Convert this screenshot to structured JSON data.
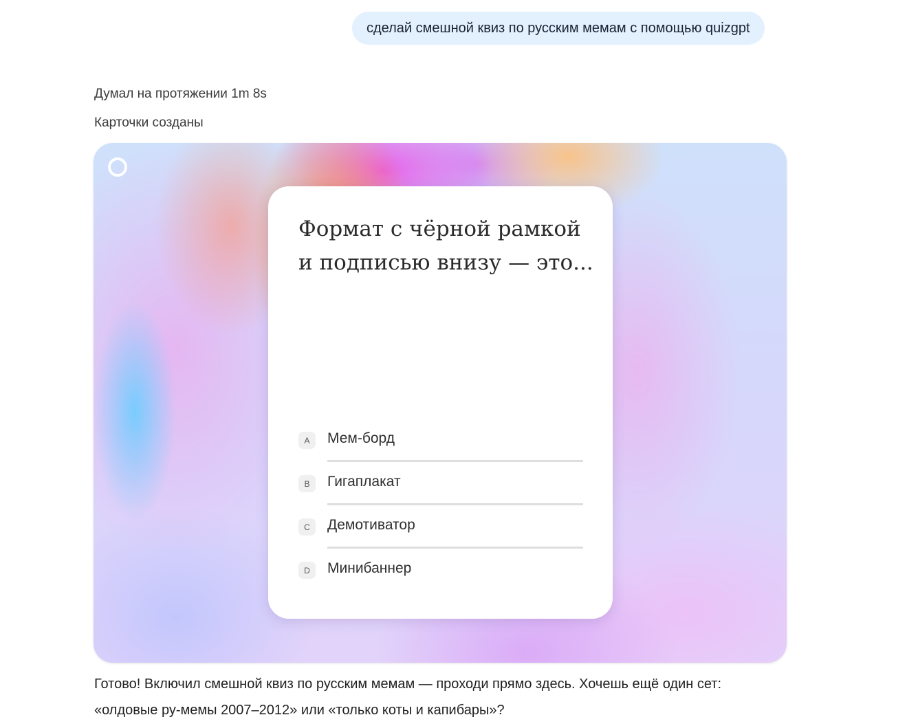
{
  "user_message": "сделай смешной квиз по русским мемам с помощью quizgpt",
  "assistant": {
    "thought_status": "Думал на протяжении 1m 8s",
    "tool_status": "Карточки созданы",
    "final_reply_line1": "Готово! Включил смешной квиз по русским мемам — проходи прямо здесь. Хочешь ещё один сет:",
    "final_reply_line2": "«олдовые ру-мемы 2007–2012» или «только коты и капибары»?"
  },
  "quiz": {
    "question": "Формат с чёрной рамкой и подписью внизу — это...",
    "options": [
      {
        "letter": "A",
        "label": "Мем-борд"
      },
      {
        "letter": "B",
        "label": "Гигаплакат"
      },
      {
        "letter": "C",
        "label": "Демотиватор"
      },
      {
        "letter": "D",
        "label": "Минибаннер"
      }
    ],
    "loader_icon": "loading-ring-icon"
  }
}
